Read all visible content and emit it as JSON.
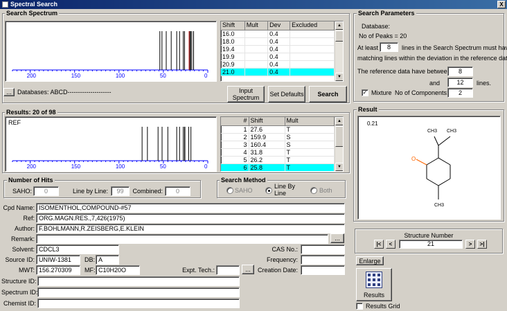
{
  "window": {
    "title": "Spectral Search",
    "close_label": "X"
  },
  "search_spectrum": {
    "title": "Search Spectrum",
    "axis_ticks": [
      "200",
      "150",
      "100",
      "50",
      "0"
    ],
    "peaks": [
      16.0,
      18.0,
      19.4,
      19.9,
      20.9,
      21.0,
      26.2,
      27.6,
      31.8,
      35.0,
      41.2,
      46.8,
      51.6,
      54.0
    ],
    "highlight_peaks": [
      21.0
    ],
    "table": {
      "headers": [
        "Shift",
        "Mult",
        "Dev",
        "Excluded"
      ],
      "rows": [
        {
          "shift": "16.0",
          "mult": "",
          "dev": "0.4",
          "excluded": ""
        },
        {
          "shift": "18.0",
          "mult": "",
          "dev": "0.4",
          "excluded": ""
        },
        {
          "shift": "19.4",
          "mult": "",
          "dev": "0.4",
          "excluded": ""
        },
        {
          "shift": "19.9",
          "mult": "",
          "dev": "0.4",
          "excluded": ""
        },
        {
          "shift": "20.9",
          "mult": "",
          "dev": "0.4",
          "excluded": ""
        },
        {
          "shift": "21.0",
          "mult": "",
          "dev": "0.4",
          "excluded": ""
        }
      ],
      "selected_row": 5
    },
    "browse_button": "...",
    "databases_label": "Databases: ABCD---------------------",
    "input_spectrum_button": "Input Spectrum",
    "set_defaults_button": "Set Defaults",
    "search_button": "Search"
  },
  "results": {
    "title": "Results: 20 of 98",
    "ref_label": "REF",
    "axis_ticks": [
      "200",
      "150",
      "100",
      "50",
      "0"
    ],
    "peaks": [
      19.0,
      21.5,
      25.8,
      26.2,
      27.6,
      31.8,
      35.0,
      45.0,
      51.5,
      56.0,
      68.0,
      74.0
    ],
    "table": {
      "headers": [
        "#",
        "Shift",
        "Mult"
      ],
      "rows": [
        {
          "n": "1",
          "shift": "27.6",
          "mult": "T"
        },
        {
          "n": "2",
          "shift": "159.9",
          "mult": "S"
        },
        {
          "n": "3",
          "shift": "160.4",
          "mult": "S"
        },
        {
          "n": "4",
          "shift": "31.8",
          "mult": "T"
        },
        {
          "n": "5",
          "shift": "26.2",
          "mult": "T"
        },
        {
          "n": "6",
          "shift": "25.8",
          "mult": "T"
        }
      ],
      "selected_row": 5
    }
  },
  "hits": {
    "title": "Number of Hits",
    "saho_label": "SAHO:",
    "saho_value": "0",
    "line_by_line_label": "Line by Line:",
    "line_by_line_value": "99",
    "combined_label": "Combined:",
    "combined_value": "0"
  },
  "search_method": {
    "title": "Search Method",
    "options": [
      "SAHO",
      "Line By Line",
      "Both"
    ],
    "selected": 1
  },
  "details": {
    "cpd_name_label": "Cpd Name:",
    "cpd_name": "ISOMENTHOL,COMPOUND-#57",
    "ref_label": "Ref:",
    "ref": "ORG.MAGN.RES.,7,426(1975)",
    "author_label": "Author:",
    "author": "F.BOHLMANN,R.ZEISBERG,E.KLEIN",
    "remark_label": "Remark:",
    "remark": "",
    "remark_button": "...",
    "solvent_label": "Solvent:",
    "solvent": "CDCL3",
    "source_id_label": "Source ID:",
    "source_id": "UNIW-1381",
    "db_label": "DB:",
    "db": "A",
    "mwt_label": "MWT:",
    "mwt": "156.270309",
    "mf_label": "MF:",
    "mf": "C10H20O",
    "expt_tech_label": "Expt. Tech.:",
    "expt_tech": "",
    "expt_button": "...",
    "cas_label": "CAS No.:",
    "cas": "",
    "frequency_label": "Frequency:",
    "frequency": "",
    "creation_date_label": "Creation Date:",
    "creation_date": "",
    "structure_id_label": "Structure ID:",
    "structure_id": "",
    "spectrum_id_label": "Spectrum ID:",
    "spectrum_id": "",
    "chemist_id_label": "Chemist ID:",
    "chemist_id": ""
  },
  "search_parameters": {
    "title": "Search Parameters",
    "database_label": "Database:",
    "no_of_peaks": "No of Peaks = 20",
    "at_least_label": "At least",
    "at_least_value": "8",
    "at_least_text": "lines in the Search Spectrum must have",
    "matching_text": "matching lines within the deviation in the reference data.",
    "between_text": "The reference data have between",
    "between_min": "8",
    "and_label": "and",
    "between_max": "12",
    "lines_label": "lines.",
    "mixture_label": "Mixture",
    "mixture_checked": true,
    "components_label": "No of Components:",
    "components_value": "2"
  },
  "result_panel": {
    "title": "Result",
    "score": "0.21",
    "atom_labels": {
      "ch3_a": "CH3",
      "ch3_b": "CH3",
      "ch3_c": "CH3",
      "oxygen": "O"
    }
  },
  "structure_number": {
    "title": "Structure Number",
    "value": "21",
    "first": "|<",
    "prev": "<",
    "next": ">",
    "last": ">|"
  },
  "enlarge_button": "Enlarge",
  "results_button": "Results",
  "results_grid_label": "Results Grid",
  "colors": {
    "highlight": "#00ffff",
    "axis": "#0000ff",
    "oxygen": "#ff6600",
    "title_start": "#0a246a",
    "title_end": "#3a6ea5"
  }
}
